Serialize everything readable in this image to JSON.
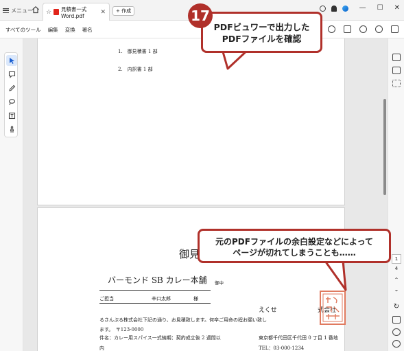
{
  "titlebar": {
    "menu_label": "メニュー",
    "tab_title": "見積書一式Word.pdf",
    "new_tab_label": "+ 作成",
    "minimize": "—",
    "maximize": "☐",
    "close": "✕"
  },
  "menubar": {
    "items": [
      "すべてのツール",
      "編集",
      "変換",
      "署名"
    ]
  },
  "page1": {
    "lines": [
      "1.　御見積書 1 部",
      "2.　内訳書 1 部"
    ]
  },
  "page2": {
    "title": "御見",
    "customer": "バーモンド SB カレー本舗",
    "honorific": "御中",
    "contact_label": "ご担当",
    "contact_name": "辛口太郎",
    "contact_sama": "様",
    "issuer_short": "えくせ",
    "issuer_suffix": "式会社",
    "body_line1": "るさんぷる株式会社下記の通り、お見積致します。何卒ご用命の程お願い致し",
    "body_line2": "ます。　〒123-0000",
    "address": "東京都千代田区千代田 0 丁目 1 番地",
    "item_line": "件名：カレー用スパイス一式納期：契約成立後 2 週間以",
    "tel": "TEL：03-000-1234",
    "tail": "内",
    "seal_text": "えくせるさんぷる"
  },
  "rightrail": {
    "page_current": "1",
    "page_total": "4"
  },
  "callouts": {
    "badge_number": "17",
    "callout1_line1": "PDFビュワーで出力した",
    "callout1_line2": "PDFファイルを確認",
    "callout2_line1": "元のPDFファイルの余白設定などによって",
    "callout2_line2": "ページが切れてしまうことも……"
  },
  "colors": {
    "accent": "#b0302a",
    "seal": "#e07a5f",
    "selection": "#dbe8fb"
  }
}
